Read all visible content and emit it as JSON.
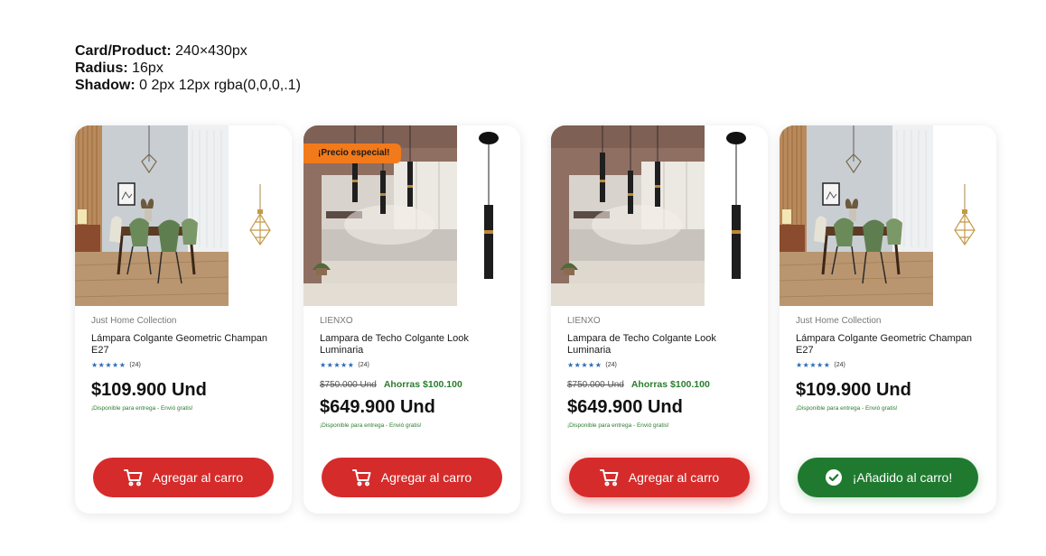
{
  "spec": {
    "card_label": "Card/Product:",
    "card_value": "240×430px",
    "radius_label": "Radius:",
    "radius_value": "16px",
    "shadow_label": "Shadow:",
    "shadow_value": "0 2px 12px rgba(0,0,0,.1)"
  },
  "colors": {
    "cart_button": "#d62b2b",
    "added_button": "#1f7a2f",
    "badge": "#f27a1a",
    "stars": "#2d6bb7",
    "stock": "#2a7d2e"
  },
  "cards": [
    {
      "brand": "Just Home Collection",
      "title": "Lámpara Colgante Geometric Champan E27",
      "stars": "★★★★★",
      "reviews": "(24)",
      "price": "$109.900 Und",
      "stock": "¡Disponible para entrega - Envió gratis!",
      "button": "Agregar al carro",
      "icon": "cart-icon"
    },
    {
      "badge": "¡Precio especial!",
      "brand": "LIENXO",
      "title": "Lampara de Techo Colgante Look Luminaria",
      "stars": "★★★★★",
      "reviews": "(24)",
      "old_price": "$750.000 Und",
      "savings": "Ahorras $100.100",
      "price": "$649.900 Und",
      "stock": "¡Disponible para entrega - Envió gratis!",
      "button": "Agregar al carro",
      "icon": "cart-icon"
    },
    {
      "brand": "LIENXO",
      "title": "Lampara de Techo Colgante Look Luminaria",
      "stars": "★★★★★",
      "reviews": "(24)",
      "old_price": "$750.000 Und",
      "savings": "Ahorras $100.100",
      "price": "$649.900 Und",
      "stock": "¡Disponible para entrega - Envió gratis!",
      "button": "Agregar al carro",
      "icon": "cart-icon"
    },
    {
      "brand": "Just Home Collection",
      "title": "Lámpara Colgante Geometric Champan E27",
      "stars": "★★★★★",
      "reviews": "(24)",
      "price": "$109.900 Und",
      "stock": "¡Disponible para entrega - Envió gratis!",
      "button": "¡Añadido al carro!",
      "icon": "check-circle-icon"
    }
  ]
}
